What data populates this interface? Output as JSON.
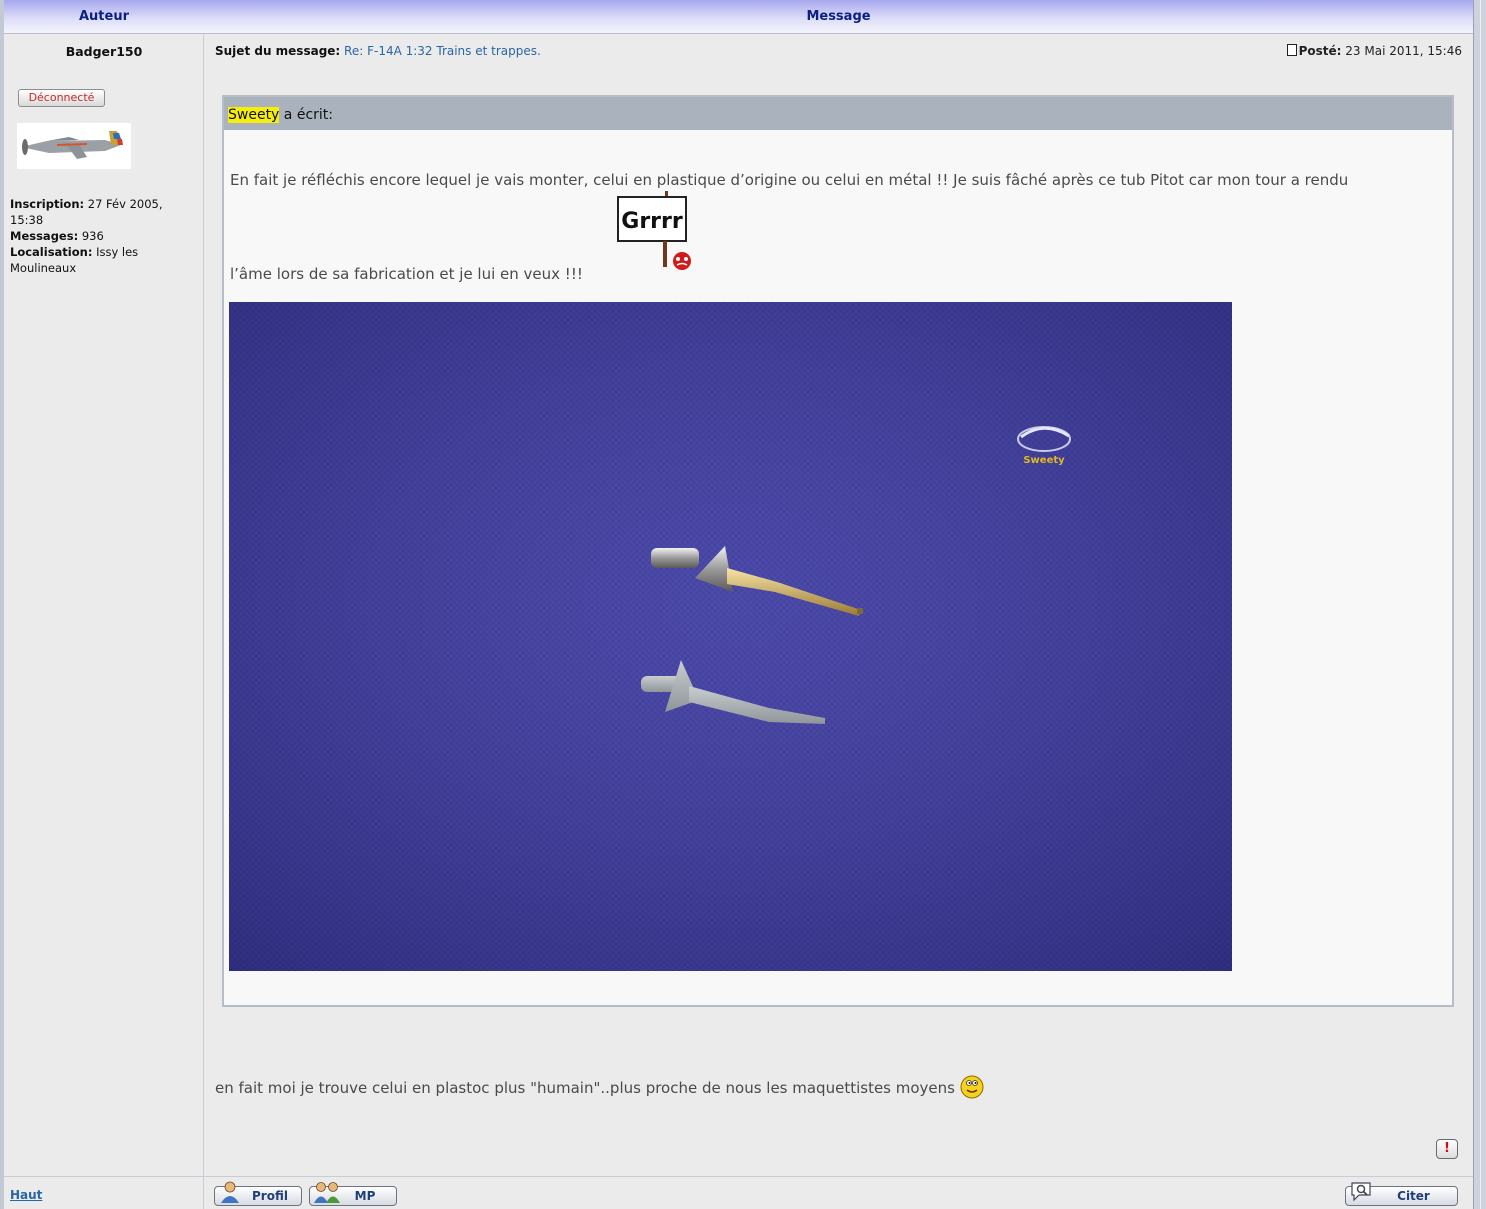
{
  "table_header": {
    "author": "Auteur",
    "message": "Message"
  },
  "author": {
    "name": "Badger150",
    "status": "Déconnecté",
    "info": [
      {
        "label": "Inscription:",
        "value": "27 Fév 2005, 15:38"
      },
      {
        "label": "Messages:",
        "value": "936"
      },
      {
        "label": "Localisation:",
        "value": "Issy les Moulineaux"
      }
    ]
  },
  "post": {
    "subject_label": "Sujet du message:",
    "subject": "Re: F-14A 1:32 Trains et trappes.",
    "posted_label": "Posté:",
    "posted_date": "23 Mai 2011, 15:46",
    "quote": {
      "author": "Sweety",
      "wrote": "a écrit:",
      "line1": "En fait je réfléchis encore lequel je vais monter, celui en plastique d’origine ou celui en métal !! Je suis fâché après ce tub Pitot car mon tour a rendu",
      "line2": "l’âme lors de sa fabrication et je lui en veux !!!",
      "sign_text": "Grrrr",
      "watermark": "Sweety"
    },
    "reply": "en fait moi je trouve celui en plastoc plus \"humain\"..plus proche de nous les maquettistes moyens",
    "report_icon": "!"
  },
  "footer": {
    "top_link": "Haut",
    "profile_button": "Profil",
    "pm_button": "MP",
    "quote_button": "Citer"
  },
  "icons": [
    "doc-icon",
    "grrr-sign-icon",
    "smiley-icon",
    "report-icon",
    "profile-icon",
    "pm-icon",
    "quote-icon"
  ]
}
